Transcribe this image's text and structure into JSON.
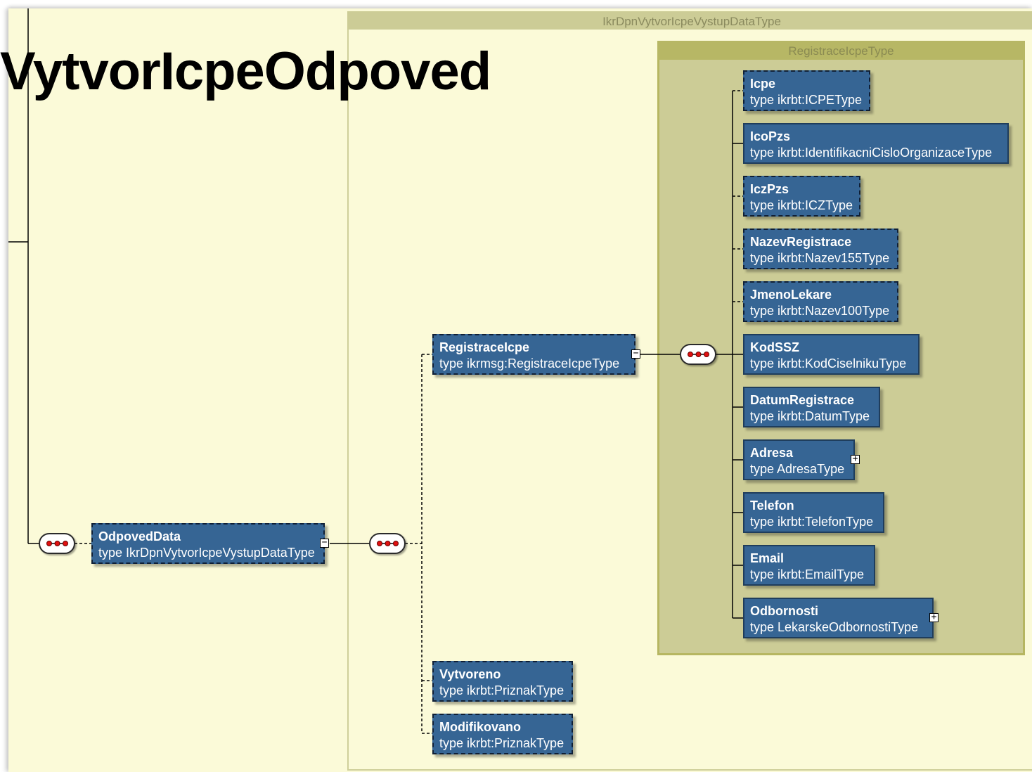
{
  "title": "VytvorIcpeOdpoved",
  "outer_group": {
    "label": "IkrDpnVytvorIcpeVystupDataType"
  },
  "inner_group": {
    "label": "RegistraceIcpeType"
  },
  "compositors": {
    "sequence_icon": "sequence-compositor-icon"
  },
  "nodes": {
    "odpoved_data": {
      "name": "OdpovedData",
      "type": "type  IkrDpnVytvorIcpeVystupDataType",
      "toggle": "⊟"
    },
    "registrace_icpe": {
      "name": "RegistraceIcpe",
      "type": "type  ikrmsg:RegistraceIcpeType",
      "toggle": "⊟"
    },
    "vytvoreno": {
      "name": "Vytvoreno",
      "type": "type  ikrbt:PriznakType"
    },
    "modifikovano": {
      "name": "Modifikovano",
      "type": "type  ikrbt:PriznakType"
    },
    "icpe": {
      "name": "Icpe",
      "type": "type  ikrbt:ICPEType"
    },
    "ico_pzs": {
      "name": "IcoPzs",
      "type": "type  ikrbt:IdentifikacniCisloOrganizaceType"
    },
    "icz_pzs": {
      "name": "IczPzs",
      "type": "type  ikrbt:ICZType"
    },
    "nazev_registrace": {
      "name": "NazevRegistrace",
      "type": "type  ikrbt:Nazev155Type"
    },
    "jmeno_lekare": {
      "name": "JmenoLekare",
      "type": "type  ikrbt:Nazev100Type"
    },
    "kod_ssz": {
      "name": "KodSSZ",
      "type": "type  ikrbt:KodCiselnikuType"
    },
    "datum_registrace": {
      "name": "DatumRegistrace",
      "type": "type  ikrbt:DatumType"
    },
    "adresa": {
      "name": "Adresa",
      "type": "type  AdresaType",
      "toggle": "⊞"
    },
    "telefon": {
      "name": "Telefon",
      "type": "type  ikrbt:TelefonType"
    },
    "email": {
      "name": "Email",
      "type": "type  ikrbt:EmailType"
    },
    "odbornosti": {
      "name": "Odbornosti",
      "type": "type  LekarskeOdbornostiType",
      "toggle": "⊞"
    }
  }
}
